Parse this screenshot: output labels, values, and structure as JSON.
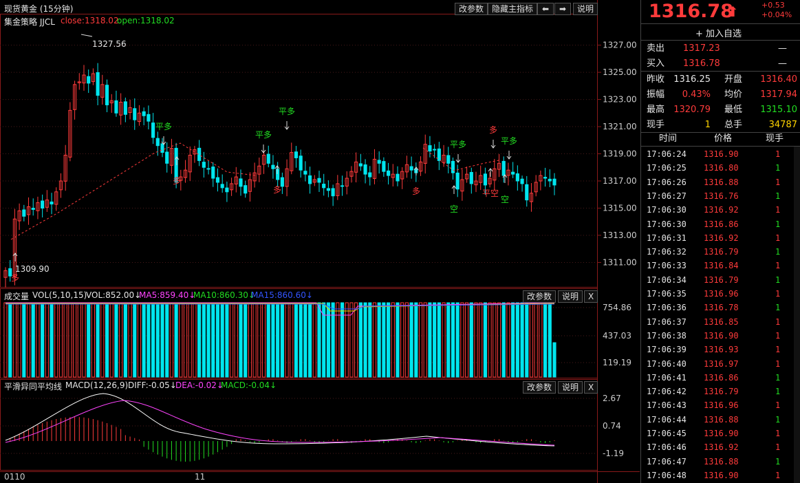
{
  "title": "现货黄金 (15分钟)",
  "toolbar": {
    "params": "改参数",
    "hide_main": "隐藏主指标",
    "left": "◆",
    "right": "◆",
    "help": "说明"
  },
  "main_panel": {
    "strategy": "集金策略 JJCL",
    "close_label": "close:1318.02",
    "open_label": "open:1318.02",
    "y_ticks": [
      "1327.00",
      "1325.00",
      "1323.00",
      "1321.00",
      "1319.00",
      "1317.00",
      "1315.00",
      "1313.00",
      "1311.00"
    ],
    "high_note": "1327.56",
    "low_note": "1309.90",
    "signals": [
      {
        "text": "多",
        "color": "#ff3b3b"
      },
      {
        "text": "平多",
        "color": "#22dd22"
      },
      {
        "text": "多",
        "color": "#ff3b3b"
      },
      {
        "text": "平多",
        "color": "#22dd22"
      },
      {
        "text": "多",
        "color": "#ff3b3b"
      },
      {
        "text": "平多",
        "color": "#22dd22"
      },
      {
        "text": "多",
        "color": "#ff3b3b"
      },
      {
        "text": "平多",
        "color": "#22dd22"
      },
      {
        "text": "空",
        "color": "#22dd22"
      },
      {
        "text": "多",
        "color": "#ff3b3b"
      },
      {
        "text": "平多",
        "color": "#22dd22"
      },
      {
        "text": "平空",
        "color": "#ff3b3b"
      },
      {
        "text": "空",
        "color": "#22dd22"
      }
    ]
  },
  "vol_panel": {
    "name": "成交量",
    "vol": "VOL(5,10,15)",
    "vol_val": "VOL:852.00↓",
    "ma5": "MA5:859.40↓",
    "ma10": "MA10:860.30↓",
    "ma15": "MA15:860.60↓",
    "y_ticks": [
      "754.86",
      "437.03",
      "119.19"
    ],
    "params": "改参数",
    "help": "说明",
    "close": "X"
  },
  "macd_panel": {
    "name": "平滑异同平均线",
    "macd": "MACD(12,26,9)",
    "diff": "DIFF:-0.05↓",
    "dea": "DEA:-0.02↓",
    "macd_val": "MACD:-0.04↓",
    "y_ticks": [
      "2.67",
      "0.74",
      "-1.19"
    ],
    "params": "改参数",
    "help": "说明",
    "close": "X"
  },
  "x_axis": {
    "labels": [
      "0110",
      "11"
    ]
  },
  "quote": {
    "price": "1316.78",
    "arrow": "⬆",
    "change": "+0.53",
    "change_pct": "+0.04%",
    "add_watch": "+ 加入自选",
    "sell_label": "卖出",
    "sell": "1317.23",
    "sell_vol": "—",
    "buy_label": "买入",
    "buy": "1316.78",
    "buy_vol": "—",
    "stats": [
      {
        "l1": "昨收",
        "v1": "1316.25",
        "c1": "white",
        "l2": "开盘",
        "v2": "1316.40",
        "c2": "red"
      },
      {
        "l1": "振幅",
        "v1": "0.43%",
        "c1": "red",
        "l2": "均价",
        "v2": "1317.94",
        "c2": "red"
      },
      {
        "l1": "最高",
        "v1": "1320.79",
        "c1": "red",
        "l2": "最低",
        "v2": "1315.10",
        "c2": "green"
      },
      {
        "l1": "现手",
        "v1": "1",
        "c1": "yellow",
        "l2": "总手",
        "v2": "34787",
        "c2": "yellow"
      }
    ],
    "tick_headers": [
      "时间",
      "价格",
      "现手"
    ],
    "ticks": [
      {
        "t": "17:06:24",
        "p": "1316.90",
        "v": "1",
        "c": "red"
      },
      {
        "t": "17:06:25",
        "p": "1316.80",
        "v": "1",
        "c": "green"
      },
      {
        "t": "17:06:26",
        "p": "1316.88",
        "v": "1",
        "c": "red"
      },
      {
        "t": "17:06:27",
        "p": "1316.76",
        "v": "1",
        "c": "green"
      },
      {
        "t": "17:06:30",
        "p": "1316.92",
        "v": "1",
        "c": "red"
      },
      {
        "t": "17:06:30",
        "p": "1316.86",
        "v": "1",
        "c": "green"
      },
      {
        "t": "17:06:31",
        "p": "1316.92",
        "v": "1",
        "c": "red"
      },
      {
        "t": "17:06:32",
        "p": "1316.79",
        "v": "1",
        "c": "green"
      },
      {
        "t": "17:06:33",
        "p": "1316.84",
        "v": "1",
        "c": "red"
      },
      {
        "t": "17:06:34",
        "p": "1316.79",
        "v": "1",
        "c": "green"
      },
      {
        "t": "17:06:35",
        "p": "1316.96",
        "v": "1",
        "c": "red"
      },
      {
        "t": "17:06:36",
        "p": "1316.78",
        "v": "1",
        "c": "green"
      },
      {
        "t": "17:06:37",
        "p": "1316.85",
        "v": "1",
        "c": "red"
      },
      {
        "t": "17:06:38",
        "p": "1316.90",
        "v": "1",
        "c": "red"
      },
      {
        "t": "17:06:39",
        "p": "1316.93",
        "v": "1",
        "c": "red"
      },
      {
        "t": "17:06:40",
        "p": "1316.97",
        "v": "1",
        "c": "red"
      },
      {
        "t": "17:06:41",
        "p": "1316.86",
        "v": "1",
        "c": "green"
      },
      {
        "t": "17:06:42",
        "p": "1316.79",
        "v": "1",
        "c": "green"
      },
      {
        "t": "17:06:43",
        "p": "1316.96",
        "v": "1",
        "c": "red"
      },
      {
        "t": "17:06:44",
        "p": "1316.88",
        "v": "1",
        "c": "green"
      },
      {
        "t": "17:06:45",
        "p": "1316.90",
        "v": "1",
        "c": "red"
      },
      {
        "t": "17:06:46",
        "p": "1316.92",
        "v": "1",
        "c": "red"
      },
      {
        "t": "17:06:47",
        "p": "1316.88",
        "v": "1",
        "c": "green"
      },
      {
        "t": "17:06:48",
        "p": "1316.90",
        "v": "1",
        "c": "red"
      }
    ]
  },
  "colors": {
    "up": "#ff3b3b",
    "down": "#00e5ee",
    "bg": "#000000",
    "grid": "#4a1a1a"
  }
}
